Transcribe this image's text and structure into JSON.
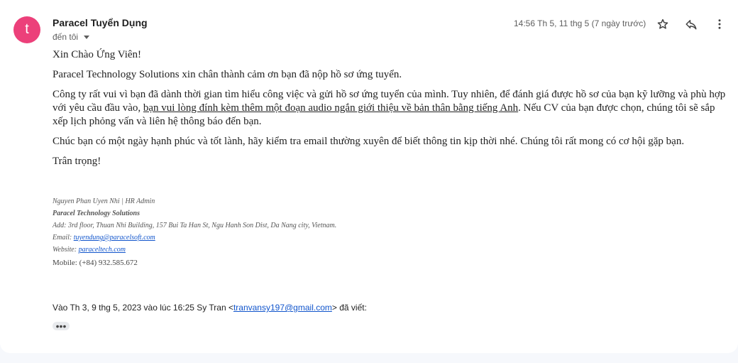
{
  "header": {
    "avatar_letter": "t",
    "avatar_color": "#ec407a",
    "sender_name": "Paracel Tuyển Dụng",
    "recipient": "đến tôi",
    "timestamp": "14:56 Th 5, 11 thg 5 (7 ngày trước)",
    "icons": [
      "star-icon",
      "reply-icon",
      "more-vert-icon"
    ]
  },
  "body": {
    "greeting": "Xin Chào Ứng Viên!",
    "p1": "Paracel Technology Solutions xin chân thành cảm ơn bạn đã nộp hồ sơ ứng tuyển.",
    "p2_before": "Công ty rất vui vì bạn đã dành thời gian tìm hiểu công việc và gửi hồ sơ ứng tuyển của mình. Tuy nhiên, để đánh giá được hồ sơ của bạn kỹ lưỡng và phù hợp với yêu cầu đầu vào, ",
    "p2_underlined": "bạn vui lòng đính kèm thêm một đoạn audio ngắn giới thiệu về bản thân bằng tiếng Anh",
    "p2_after": ". Nếu CV của bạn được chọn, chúng tôi sẽ sắp xếp lịch phỏng vấn và liên hệ thông báo đến bạn.",
    "p3": "Chúc bạn có một ngày hạnh phúc và tốt lành, hãy kiểm tra email thường xuyên để biết thông tin kịp thời nhé. Chúng tôi rất mong có cơ hội gặp bạn.",
    "closing": "Trân trọng!"
  },
  "signature": {
    "name_line": "Nguyen Phan Uyen Nhi | HR Admin",
    "company": "Paracel Technology Solutions",
    "address": "Add: 3rd floor, Thuan Nhi Building, 157 Bui Ta Han St, Ngu Hanh Son Dist, Da Nang city, Vietnam.",
    "email_label": "Email: ",
    "email": "tuyendung@paracelsoft.com",
    "website_label": "Website: ",
    "website": "paraceltech.com",
    "mobile": "Mobile: (+84) 932.585.672"
  },
  "quoted": {
    "prefix": "Vào Th 3, 9 thg 5, 2023 vào lúc 16:25 Sy Tran <",
    "email": "tranvansy197@gmail.com",
    "suffix": "> đã viết:",
    "expand_label": "•••"
  }
}
